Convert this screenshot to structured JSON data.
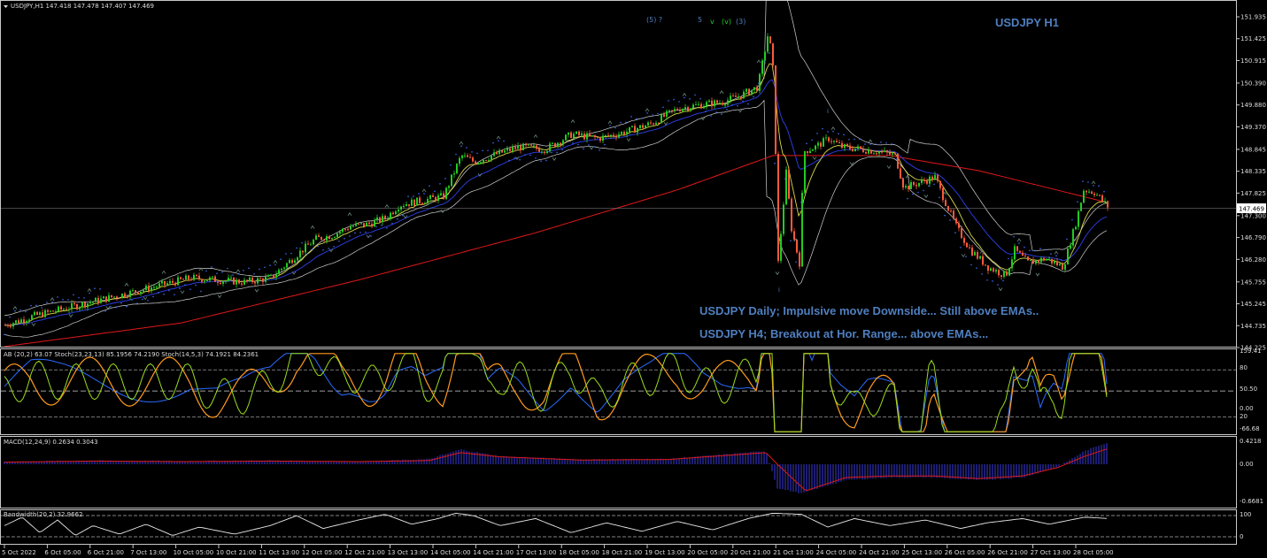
{
  "colors": {
    "background": "#000000",
    "grid_frame": "#c8c8c8",
    "bull": "#22cc22",
    "bear": "#ff5a3c",
    "ema200": "#e01818",
    "ema_blue": "#2a3cd8",
    "ema_yellow": "#d8d84a",
    "boll": "#d0d0d0",
    "psar": "#3a6cff",
    "stoch_orange": "#ff9a1e",
    "rsi_green": "#9adc1e",
    "stoch_blue": "#2a6cff",
    "macd_hist": "#3a3ae0",
    "macd_signal": "#e01818",
    "bandwidth": "#e8e8e8",
    "annotation": "#4f7fbf"
  },
  "header": {
    "symbol_line": "USDJPY,H1  147.418 147.478 147.407 147.469"
  },
  "annotations": {
    "title": "USDJPY H1",
    "wave_label_1": "(5) ?",
    "wave_label_2": "5",
    "wave_label_3": "v",
    "wave_label_4": "(v)",
    "wave_label_5": "(3)",
    "wave_label_i1": "i",
    "wave_label_i2": "i",
    "note_daily": "USDJPY Daily; Impulsive move Downside... Still above EMAs..",
    "note_h4": "USDJPY H4; Breakout at Hor. Range... above EMAs..."
  },
  "chart_data": {
    "type": "candlestick",
    "symbol": "USDJPY",
    "timeframe": "H1",
    "x_ticks": [
      "5 Oct 2022",
      "6 Oct 05:00",
      "6 Oct 21:00",
      "7 Oct 13:00",
      "10 Oct 05:00",
      "10 Oct 21:00",
      "11 Oct 13:00",
      "12 Oct 05:00",
      "12 Oct 21:00",
      "13 Oct 13:00",
      "14 Oct 05:00",
      "14 Oct 21:00",
      "17 Oct 13:00",
      "18 Oct 05:00",
      "18 Oct 21:00",
      "19 Oct 13:00",
      "20 Oct 05:00",
      "20 Oct 21:00",
      "21 Oct 13:00",
      "24 Oct 05:00",
      "24 Oct 21:00",
      "25 Oct 13:00",
      "26 Oct 05:00",
      "26 Oct 21:00",
      "27 Oct 13:00",
      "28 Oct 05:00"
    ],
    "y_ticks": [
      "151.935",
      "151.425",
      "150.915",
      "150.390",
      "149.880",
      "149.370",
      "148.845",
      "148.335",
      "147.825",
      "147.300",
      "146.790",
      "146.280",
      "145.755",
      "145.245",
      "144.735",
      "144.225"
    ],
    "y_range": [
      144.225,
      151.935
    ],
    "current_price": "147.469",
    "close_path": [
      [
        0,
        144.75
      ],
      [
        30,
        144.95
      ],
      [
        60,
        145.1
      ],
      [
        90,
        145.25
      ],
      [
        120,
        145.4
      ],
      [
        150,
        145.55
      ],
      [
        180,
        145.7
      ],
      [
        210,
        145.85
      ],
      [
        240,
        145.8
      ],
      [
        270,
        145.75
      ],
      [
        300,
        145.85
      ],
      [
        330,
        146.4
      ],
      [
        350,
        146.75
      ],
      [
        370,
        146.85
      ],
      [
        390,
        147.05
      ],
      [
        410,
        147.1
      ],
      [
        430,
        147.25
      ],
      [
        445,
        147.55
      ],
      [
        470,
        147.65
      ],
      [
        495,
        147.75
      ],
      [
        515,
        148.7
      ],
      [
        530,
        148.55
      ],
      [
        550,
        148.7
      ],
      [
        580,
        148.9
      ],
      [
        610,
        148.85
      ],
      [
        640,
        149.2
      ],
      [
        670,
        149.1
      ],
      [
        700,
        149.25
      ],
      [
        730,
        149.45
      ],
      [
        760,
        149.8
      ],
      [
        790,
        149.9
      ],
      [
        810,
        149.95
      ],
      [
        830,
        150.1
      ],
      [
        850,
        150.3
      ],
      [
        862,
        151.6
      ],
      [
        868,
        150.55
      ],
      [
        873,
        146.2
      ],
      [
        882,
        148.3
      ],
      [
        888,
        147.0
      ],
      [
        897,
        146.2
      ],
      [
        902,
        148.8
      ],
      [
        915,
        148.9
      ],
      [
        930,
        149.1
      ],
      [
        945,
        148.9
      ],
      [
        965,
        148.85
      ],
      [
        985,
        148.8
      ],
      [
        1005,
        148.7
      ],
      [
        1015,
        147.95
      ],
      [
        1030,
        148.05
      ],
      [
        1050,
        148.2
      ],
      [
        1060,
        147.7
      ],
      [
        1075,
        147.0
      ],
      [
        1090,
        146.5
      ],
      [
        1110,
        146.1
      ],
      [
        1130,
        145.9
      ],
      [
        1140,
        146.5
      ],
      [
        1155,
        146.2
      ],
      [
        1175,
        146.3
      ],
      [
        1195,
        146.1
      ],
      [
        1210,
        147.2
      ],
      [
        1218,
        147.9
      ],
      [
        1230,
        147.85
      ],
      [
        1247,
        147.47
      ]
    ],
    "ema200_path": [
      [
        0,
        144.25
      ],
      [
        200,
        144.8
      ],
      [
        400,
        145.8
      ],
      [
        600,
        146.9
      ],
      [
        760,
        147.9
      ],
      [
        868,
        148.7
      ],
      [
        1000,
        148.7
      ],
      [
        1100,
        148.35
      ],
      [
        1247,
        147.6
      ]
    ],
    "stoch_panel": {
      "label": "AB (20,2) 63.07  Stoch(23,23,13) 85.1956 74.2190  Stoch(14,5,3) 74.1921 84.2361",
      "y_ticks": [
        "159.41",
        "80",
        "50.50",
        "0.00",
        "20",
        "-66.68"
      ]
    },
    "macd_panel": {
      "label": "MACD(12,24,9) 0.2634 0.3043",
      "y_ticks": [
        "0.4218",
        "0.00",
        "-0.6681"
      ],
      "histogram": [
        [
          0,
          0.05
        ],
        [
          100,
          0.07
        ],
        [
          200,
          0.06
        ],
        [
          300,
          0.07
        ],
        [
          400,
          0.05
        ],
        [
          480,
          0.1
        ],
        [
          515,
          0.28
        ],
        [
          560,
          0.15
        ],
        [
          650,
          0.09
        ],
        [
          750,
          0.1
        ],
        [
          860,
          0.25
        ],
        [
          873,
          -0.45
        ],
        [
          900,
          -0.55
        ],
        [
          950,
          -0.3
        ],
        [
          1000,
          -0.25
        ],
        [
          1050,
          -0.25
        ],
        [
          1100,
          -0.3
        ],
        [
          1150,
          -0.25
        ],
        [
          1190,
          -0.05
        ],
        [
          1220,
          0.25
        ],
        [
          1247,
          0.42
        ]
      ],
      "signal": [
        [
          0,
          0.04
        ],
        [
          100,
          0.06
        ],
        [
          200,
          0.05
        ],
        [
          300,
          0.06
        ],
        [
          400,
          0.05
        ],
        [
          480,
          0.07
        ],
        [
          515,
          0.22
        ],
        [
          560,
          0.14
        ],
        [
          650,
          0.08
        ],
        [
          750,
          0.09
        ],
        [
          860,
          0.22
        ],
        [
          873,
          0.0
        ],
        [
          905,
          -0.5
        ],
        [
          950,
          -0.25
        ],
        [
          1000,
          -0.22
        ],
        [
          1050,
          -0.22
        ],
        [
          1100,
          -0.27
        ],
        [
          1150,
          -0.22
        ],
        [
          1190,
          -0.06
        ],
        [
          1220,
          0.15
        ],
        [
          1247,
          0.3
        ]
      ]
    },
    "bandwidth_panel": {
      "label": "Bandwidth(20,2) 32.9662",
      "y_ticks": [
        "100",
        "0"
      ],
      "series": [
        [
          0,
          0.55
        ],
        [
          20,
          0.85
        ],
        [
          40,
          0.3
        ],
        [
          60,
          0.75
        ],
        [
          80,
          0.2
        ],
        [
          100,
          0.55
        ],
        [
          130,
          0.25
        ],
        [
          160,
          0.6
        ],
        [
          190,
          0.2
        ],
        [
          220,
          0.5
        ],
        [
          260,
          0.25
        ],
        [
          300,
          0.55
        ],
        [
          330,
          0.9
        ],
        [
          360,
          0.45
        ],
        [
          400,
          0.75
        ],
        [
          430,
          0.95
        ],
        [
          460,
          0.6
        ],
        [
          490,
          0.8
        ],
        [
          510,
          0.99
        ],
        [
          530,
          0.9
        ],
        [
          560,
          0.55
        ],
        [
          600,
          0.8
        ],
        [
          640,
          0.3
        ],
        [
          680,
          0.65
        ],
        [
          720,
          0.35
        ],
        [
          760,
          0.7
        ],
        [
          800,
          0.4
        ],
        [
          840,
          0.8
        ],
        [
          868,
          0.99
        ],
        [
          900,
          0.95
        ],
        [
          930,
          0.5
        ],
        [
          960,
          0.8
        ],
        [
          1000,
          0.55
        ],
        [
          1040,
          0.75
        ],
        [
          1080,
          0.45
        ],
        [
          1110,
          0.65
        ],
        [
          1150,
          0.8
        ],
        [
          1180,
          0.6
        ],
        [
          1220,
          0.85
        ],
        [
          1247,
          0.8
        ]
      ]
    }
  }
}
